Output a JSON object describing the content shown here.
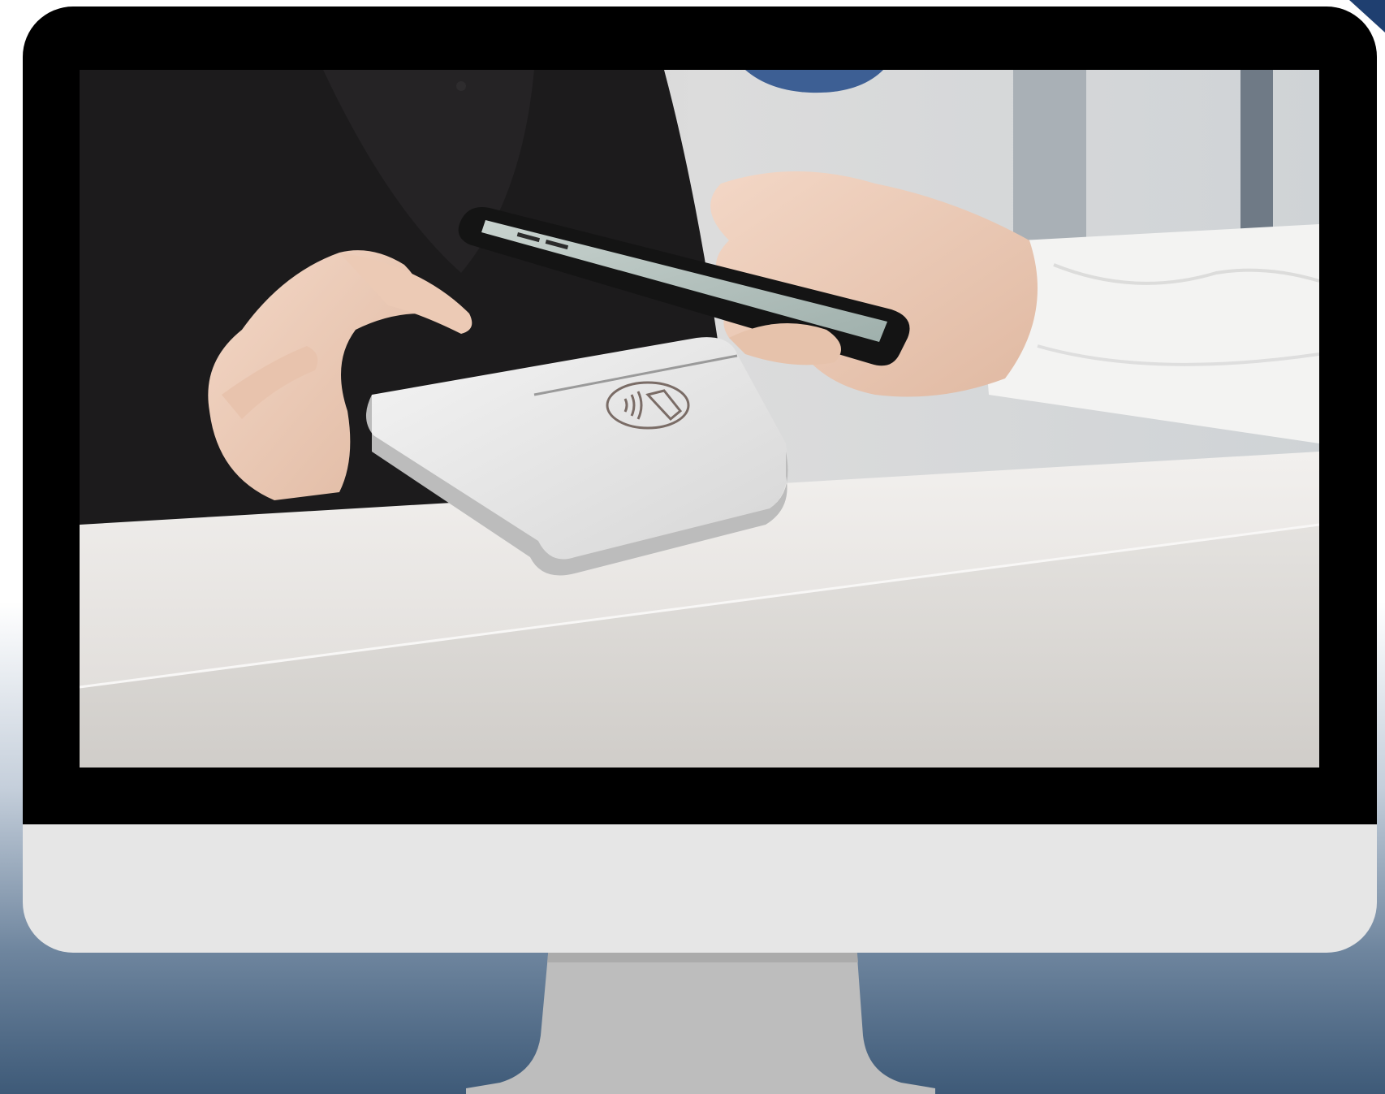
{
  "scene": {
    "description_icon": "monitor-icon",
    "screen_content_icon": "contactless-payment-photo-icon",
    "contactless_symbol_icon": "contactless-symbol-icon"
  },
  "colors": {
    "bezel": "#000000",
    "chin": "#e6e6e6",
    "stand": "#bdbdbd",
    "background_top": "#ffffff",
    "background_bottom": "#3e5a78",
    "accent": "#1f3f70"
  }
}
